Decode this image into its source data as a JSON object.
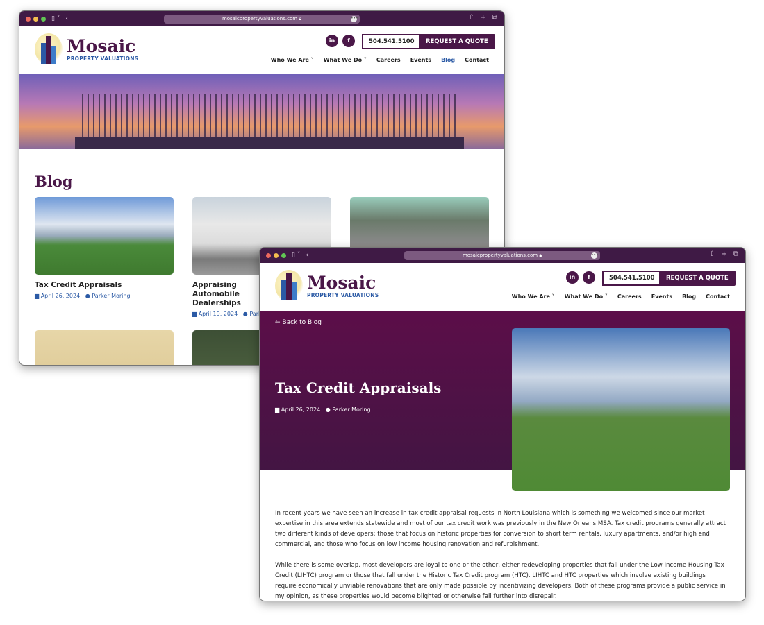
{
  "browser": {
    "url": "mosaicpropertyvaluations.com"
  },
  "brand": {
    "name": "Mosaic",
    "tagline": "PROPERTY VALUATIONS",
    "primary_color": "#4a1748",
    "link_color": "#2b5aa5"
  },
  "header": {
    "phone": "504.541.5100",
    "quote_button": "REQUEST A QUOTE",
    "social": [
      "linkedin-icon",
      "facebook-icon"
    ],
    "nav": [
      "Who We Are",
      "What We Do",
      "Careers",
      "Events",
      "Blog",
      "Contact"
    ]
  },
  "blog_page": {
    "title": "Blog",
    "cards": [
      {
        "title": "Tax Credit Appraisals",
        "date": "April 26, 2024",
        "author": "Parker Moring"
      },
      {
        "title": "Appraising Automobile Dealerships",
        "date": "April 19, 2024",
        "author": "Parker Moring"
      },
      {
        "title": "",
        "date": "",
        "author": ""
      }
    ]
  },
  "post_page": {
    "back_link": "Back to Blog",
    "title": "Tax Credit Appraisals",
    "date": "April 26, 2024",
    "author": "Parker Moring",
    "paragraphs": [
      "In recent years we have seen an increase in tax credit appraisal requests in North Louisiana which is something we welcomed since our market expertise in this area extends statewide and most of our tax credit work was previously in the New Orleans MSA. Tax credit programs generally attract two different kinds of developers: those that focus on historic properties for conversion to short term rentals, luxury apartments, and/or high end commercial, and those who focus on low income housing renovation and refurbishment.",
      "While there is some overlap, most developers are loyal to one or the other, either redeveloping properties that fall under the Low Income Housing Tax Credit (LIHTC) program or those that fall under the Historic Tax Credit program (HTC). LIHTC and HTC properties which involve existing buildings require economically unviable renovations that are only made possible by incentivizing developers. Both of these programs provide a public service in my opinion, as these properties would become blighted or otherwise fall further into disrepair."
    ]
  }
}
